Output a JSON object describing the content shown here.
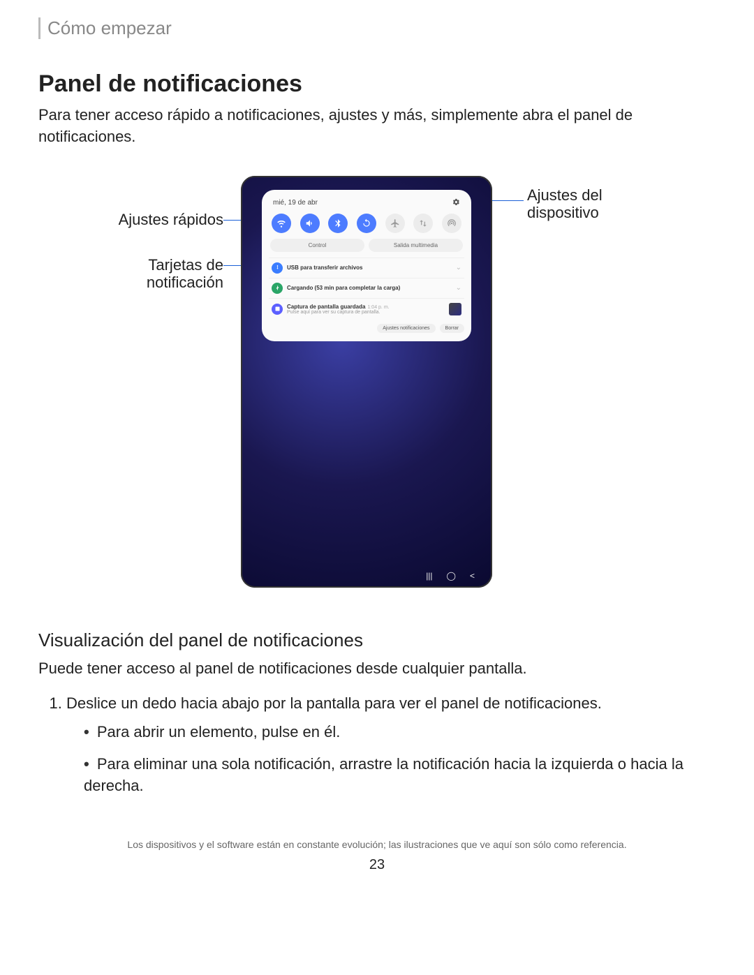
{
  "breadcrumb": "Cómo empezar",
  "h1": "Panel de notificaciones",
  "intro": "Para tener acceso rápido a notificaciones, ajustes y más, simplemente abra el panel de notificaciones.",
  "labels": {
    "quick_settings": "Ajustes rápidos",
    "notification_cards": "Tarjetas de notificación",
    "device_settings": "Ajustes del dispositivo"
  },
  "panel": {
    "date": "mié, 19 de abr",
    "segments": {
      "control": "Control",
      "media": "Salida multimedia"
    },
    "notifications": [
      {
        "icon": "usb",
        "title": "USB para transferir archivos",
        "sub": ""
      },
      {
        "icon": "charge",
        "title": "Cargando (53 min para completar la carga)",
        "sub": ""
      },
      {
        "icon": "screenshot",
        "title": "Captura de pantalla guardada",
        "time": "1:04 p. m.",
        "sub": "Pulse aquí para ver su captura de pantalla."
      }
    ],
    "footer": {
      "settings": "Ajustes notificaciones",
      "clear": "Borrar"
    }
  },
  "h2": "Visualización del panel de notificaciones",
  "body_text": "Puede tener acceso al panel de notificaciones desde cualquier pantalla.",
  "ol_item": "Deslice un dedo hacia abajo por la pantalla para ver el panel de notificaciones.",
  "ul_items": [
    "Para abrir un elemento, pulse en él.",
    "Para eliminar una sola notificación, arrastre la notificación hacia la izquierda o hacia la derecha."
  ],
  "footnote": "Los dispositivos y el software están en constante evolución; las ilustraciones que ve aquí son sólo como referencia.",
  "page_number": "23"
}
